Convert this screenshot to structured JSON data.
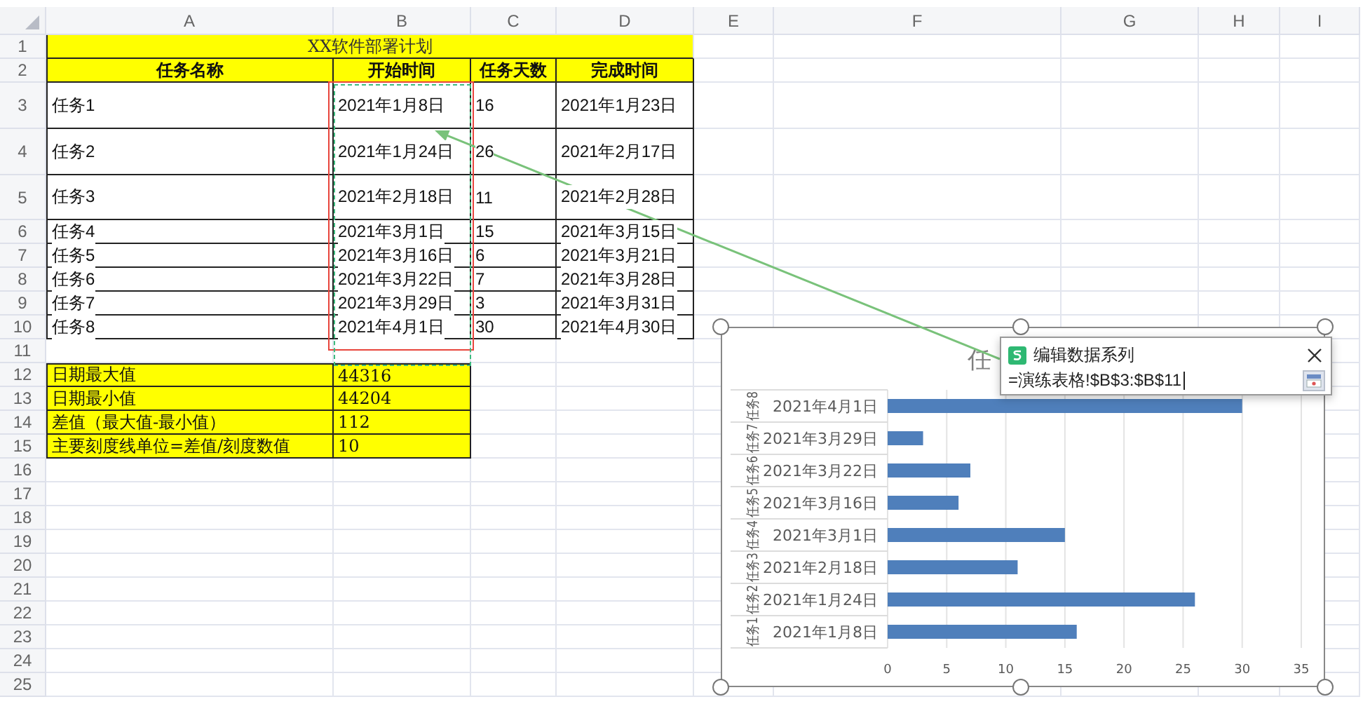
{
  "sheet": {
    "columns": [
      "A",
      "B",
      "C",
      "D",
      "E",
      "F",
      "G",
      "H",
      "I"
    ],
    "row_numbers": [
      "1",
      "2",
      "3",
      "4",
      "5",
      "6",
      "7",
      "8",
      "9",
      "10",
      "11",
      "12",
      "13",
      "14",
      "15",
      "16",
      "17",
      "18",
      "19",
      "20",
      "21",
      "22",
      "23",
      "24",
      "25"
    ],
    "title": "XX软件部署计划",
    "header": [
      "任务名称",
      "开始时间",
      "任务天数",
      "完成时间"
    ],
    "tasks": [
      [
        "任务1",
        "2021年1月8日",
        "16",
        "2021年1月23日"
      ],
      [
        "任务2",
        "2021年1月24日",
        "26",
        "2021年2月17日"
      ],
      [
        "任务3",
        "2021年2月18日",
        "11",
        "2021年2月28日"
      ],
      [
        "任务4",
        "2021年3月1日",
        "15",
        "2021年3月15日"
      ],
      [
        "任务5",
        "2021年3月16日",
        "6",
        "2021年3月21日"
      ],
      [
        "任务6",
        "2021年3月22日",
        "7",
        "2021年3月28日"
      ],
      [
        "任务7",
        "2021年3月29日",
        "3",
        "2021年3月31日"
      ],
      [
        "任务8",
        "2021年4月1日",
        "30",
        "2021年4月30日"
      ]
    ],
    "summary": [
      [
        "日期最大值",
        "44316"
      ],
      [
        "日期最小值",
        "44204"
      ],
      [
        "差值（最大值-最小值）",
        "112"
      ],
      [
        "主要刻度线单位=差值/刻度数值",
        "10"
      ]
    ]
  },
  "chart": {
    "chart_data": {
      "type": "bar",
      "orientation": "horizontal",
      "title": "任",
      "categories": [
        [
          "任务8",
          "2021年4月1日"
        ],
        [
          "任务7",
          "2021年3月29日"
        ],
        [
          "任务6",
          "2021年3月22日"
        ],
        [
          "任务5",
          "2021年3月16日"
        ],
        [
          "任务4",
          "2021年3月1日"
        ],
        [
          "任务3",
          "2021年2月18日"
        ],
        [
          "任务2",
          "2021年1月24日"
        ],
        [
          "任务1",
          "2021年1月8日"
        ]
      ],
      "series": [
        {
          "color": "#4f7fbb",
          "values": [
            30,
            3,
            7,
            6,
            15,
            11,
            26,
            16
          ]
        }
      ],
      "xlim": [
        0,
        35
      ],
      "xticks": [
        0,
        5,
        10,
        15,
        20,
        25,
        30,
        35
      ],
      "grid": true
    }
  },
  "dialog": {
    "title": "编辑数据系列",
    "value": "=演练表格!$B$3:$B$11"
  }
}
